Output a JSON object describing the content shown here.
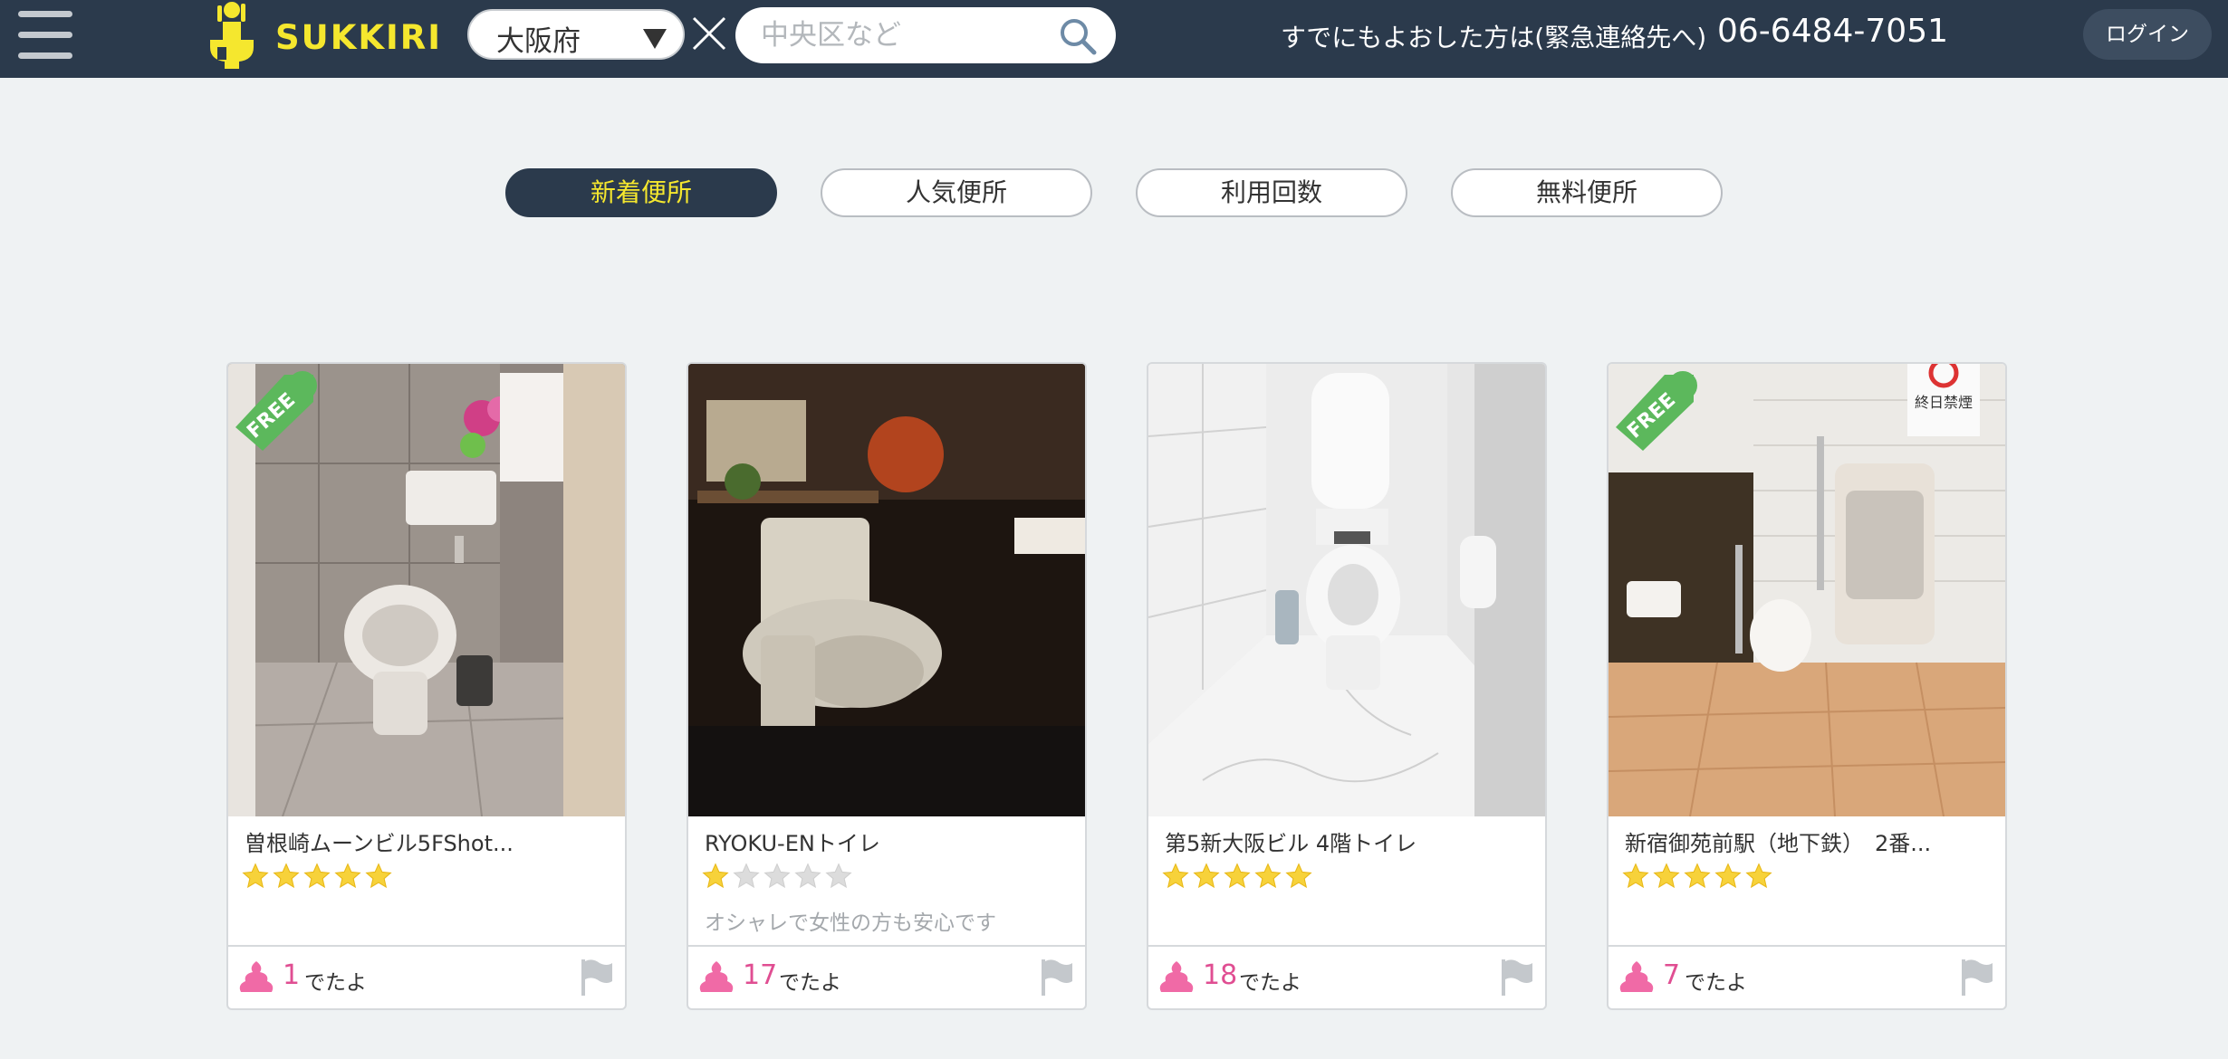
{
  "header": {
    "logo_text": "SUKKIRI",
    "prefecture": "大阪府",
    "search_placeholder": "中央区など",
    "emergency_label": "すでにもよおした方は(緊急連絡先へ)",
    "emergency_phone": "06-6484-7051",
    "login_label": "ログイン",
    "colors": {
      "bar": "#2b3a4c",
      "brand": "#f5e72e"
    }
  },
  "tabs": [
    {
      "label": "新着便所",
      "active": true
    },
    {
      "label": "人気便所",
      "active": false
    },
    {
      "label": "利用回数",
      "active": false
    },
    {
      "label": "無料便所",
      "active": false
    }
  ],
  "cards": [
    {
      "title": "曽根崎ムーンビル5FShot...",
      "rating": 5,
      "comment": "",
      "count": "1",
      "count_label": "でたよ",
      "free": true,
      "free_label": "FREE"
    },
    {
      "title": "RYOKU-ENトイレ",
      "rating": 1,
      "comment": "オシャレで女性の方も安心です",
      "count": "17",
      "count_label": "でたよ",
      "free": false
    },
    {
      "title": "第5新大阪ビル 4階トイレ",
      "rating": 5,
      "comment": "",
      "count": "18",
      "count_label": "でたよ",
      "free": false
    },
    {
      "title": "新宿御苑前駅（地下鉄）　2番...",
      "rating": 5,
      "comment": "",
      "count": "7",
      "count_label": "でたよ",
      "free": true,
      "free_label": "FREE"
    }
  ],
  "icons": {
    "menu": "hamburger-icon",
    "search": "search-icon",
    "poop": "poop-icon",
    "flag": "flag-icon",
    "star": "star-icon"
  }
}
